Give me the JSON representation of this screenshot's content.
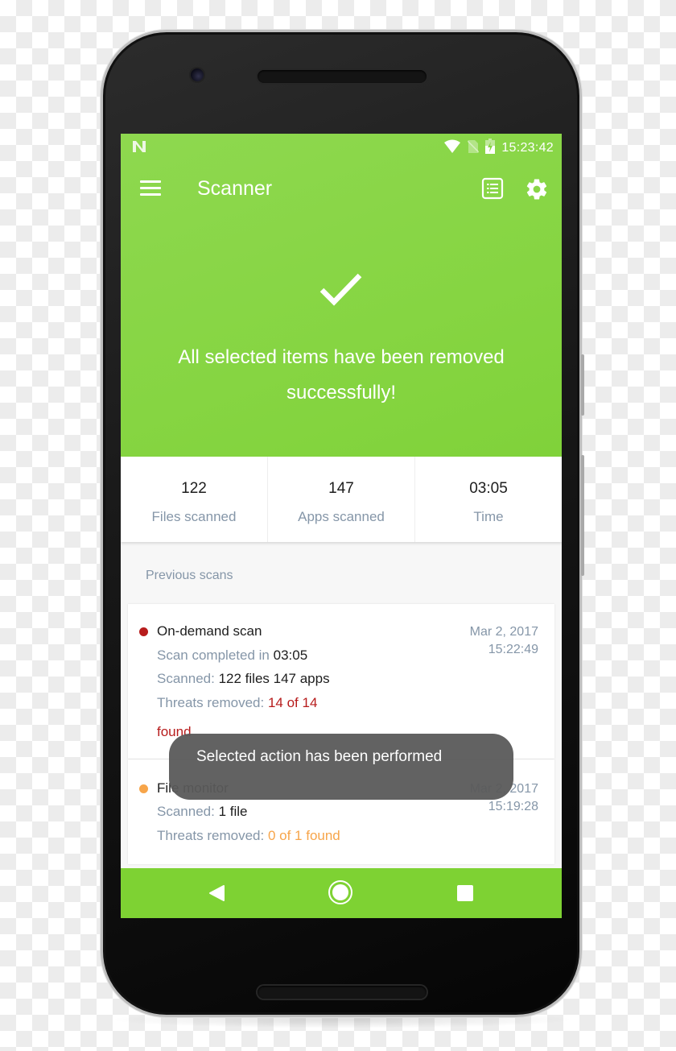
{
  "status_bar": {
    "notification_icon": "n-logo-icon",
    "icons": [
      "wifi-icon",
      "no-sim-icon",
      "battery-charging-icon"
    ],
    "time": "15:23:42"
  },
  "toolbar": {
    "menu_icon": "hamburger-menu-icon",
    "title": "Scanner",
    "actions": [
      "report-list-icon",
      "gear-icon"
    ]
  },
  "result": {
    "icon": "checkmark-icon",
    "message": "All selected items have been removed successfully!"
  },
  "stats": [
    {
      "value": "122",
      "label": "Files scanned"
    },
    {
      "value": "147",
      "label": "Apps scanned"
    },
    {
      "value": "03:05",
      "label": "Time"
    }
  ],
  "previous_scans": {
    "title": "Previous scans",
    "items": [
      {
        "title": "On-demand scan",
        "status_color": "#b71c1c",
        "date": "Mar 2, 2017",
        "time": "15:22:49",
        "completed_label": "Scan completed in",
        "completed_value": "03:05",
        "scanned_label": "Scanned:",
        "scanned_value": "122 files 147 apps",
        "threats_label": "Threats removed:",
        "threats_value": "14 of 14",
        "threats_suffix": "found"
      },
      {
        "title": "File monitor",
        "status_color": "#f7a54a",
        "date": "Mar 2, 2017",
        "time": "15:19:28",
        "scanned_label": "Scanned:",
        "scanned_value": "1 file",
        "threats_label": "Threats removed:",
        "threats_value": "0 of 1 found"
      }
    ]
  },
  "toast": {
    "message": "Selected action has been performed"
  },
  "nav_bar": {
    "buttons": [
      "back-icon",
      "home-icon",
      "recents-icon"
    ]
  },
  "colors": {
    "brand_green": "#86d542",
    "nav_green": "#7ed233",
    "danger_red": "#b71c1c",
    "warning_orange": "#f7a54a",
    "muted_text": "#8596a8"
  }
}
